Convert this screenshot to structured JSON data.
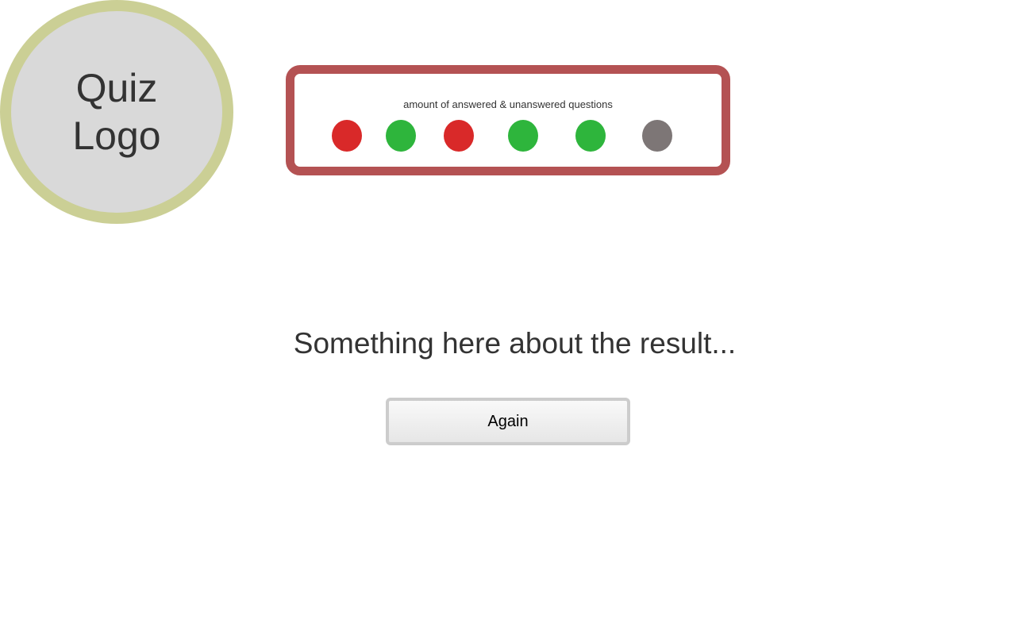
{
  "logo": {
    "line1": "Quiz",
    "line2": "Logo"
  },
  "progress": {
    "caption": "amount of answered & unanswered questions",
    "questions": [
      {
        "status": "wrong",
        "color": "#d92929"
      },
      {
        "status": "correct",
        "color": "#2eb53c"
      },
      {
        "status": "wrong",
        "color": "#d92929"
      },
      {
        "status": "correct",
        "color": "#2eb53c"
      },
      {
        "status": "correct",
        "color": "#2eb53c"
      },
      {
        "status": "unanswered",
        "color": "#7d7676"
      }
    ]
  },
  "result": {
    "text": "Something here about the result..."
  },
  "actions": {
    "again_label": "Again"
  },
  "colors": {
    "logo_ring": "#cbcf95",
    "logo_fill": "#d9d9d9",
    "panel_border": "#b45253",
    "correct": "#2eb53c",
    "wrong": "#d92929",
    "unanswered": "#7d7676"
  }
}
